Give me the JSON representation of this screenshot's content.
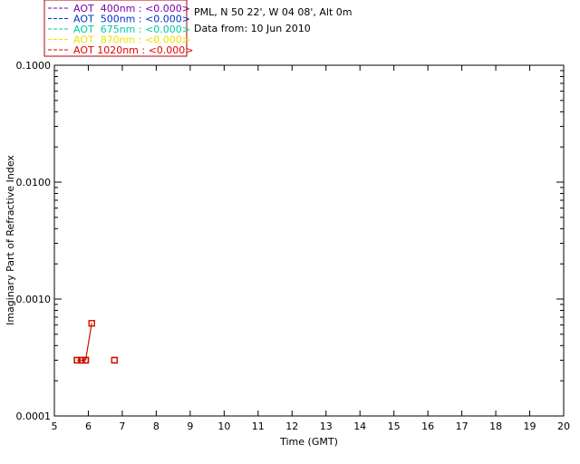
{
  "info": {
    "line1": "PML, N 50 22', W 04 08', Alt 0m",
    "line2": "Data from: 10 Jun 2010"
  },
  "legend": {
    "border_color": "#b00000",
    "items": [
      {
        "label": "AOT  400nm : <0.000>",
        "color": "#7a00a8"
      },
      {
        "label": "AOT  500nm : <0.000>",
        "color": "#0033cc"
      },
      {
        "label": "AOT  675nm : <0.000>",
        "color": "#00c9a0"
      },
      {
        "label": "AOT  870nm : <0.000>",
        "color": "#f0e000"
      },
      {
        "label": "AOT 1020nm : <0.000>",
        "color": "#e00000"
      }
    ]
  },
  "chart_data": {
    "type": "scatter",
    "xlabel": "Time (GMT)",
    "ylabel": "Imaginary Part of Refractive Index",
    "xlim": [
      5,
      20
    ],
    "ylim": [
      0.0001,
      0.1
    ],
    "yscale": "log",
    "xticks": [
      "5",
      "6",
      "7",
      "8",
      "9",
      "10",
      "11",
      "12",
      "13",
      "14",
      "15",
      "16",
      "17",
      "18",
      "19",
      "20"
    ],
    "yticks": [
      {
        "value": 0.1,
        "label": "0.1000"
      },
      {
        "value": 0.01,
        "label": "0.0100"
      },
      {
        "value": 0.001,
        "label": "0.0010"
      },
      {
        "value": 0.0001,
        "label": "0.0001"
      }
    ],
    "grid": false,
    "series": [
      {
        "name": "AOT  400nm : <0.000>",
        "color": "#7a00a8",
        "x": [
          5.67,
          5.8,
          5.92,
          6.1,
          6.77
        ],
        "y": [
          0.0003,
          0.0003,
          0.0003,
          0.00062,
          0.0003
        ]
      },
      {
        "name": "AOT  500nm : <0.000>",
        "color": "#0033cc",
        "x": [
          5.67,
          5.8,
          5.92,
          6.1,
          6.77
        ],
        "y": [
          0.0003,
          0.0003,
          0.0003,
          0.00062,
          0.0003
        ]
      },
      {
        "name": "AOT  675nm : <0.000>",
        "color": "#00c9a0",
        "x": [
          5.67,
          5.8,
          5.92,
          6.1,
          6.77
        ],
        "y": [
          0.0003,
          0.0003,
          0.0003,
          0.00062,
          0.0003
        ]
      },
      {
        "name": "AOT  870nm : <0.000>",
        "color": "#f0e000",
        "x": [
          5.67,
          5.8,
          5.92,
          6.1,
          6.77
        ],
        "y": [
          0.0003,
          0.0003,
          0.0003,
          0.00062,
          0.0003
        ]
      },
      {
        "name": "AOT 1020nm : <0.000>",
        "color": "#e00000",
        "x": [
          5.67,
          5.8,
          5.92,
          6.1,
          6.77
        ],
        "y": [
          0.0003,
          0.0003,
          0.0003,
          0.00062,
          0.0003
        ]
      }
    ]
  }
}
